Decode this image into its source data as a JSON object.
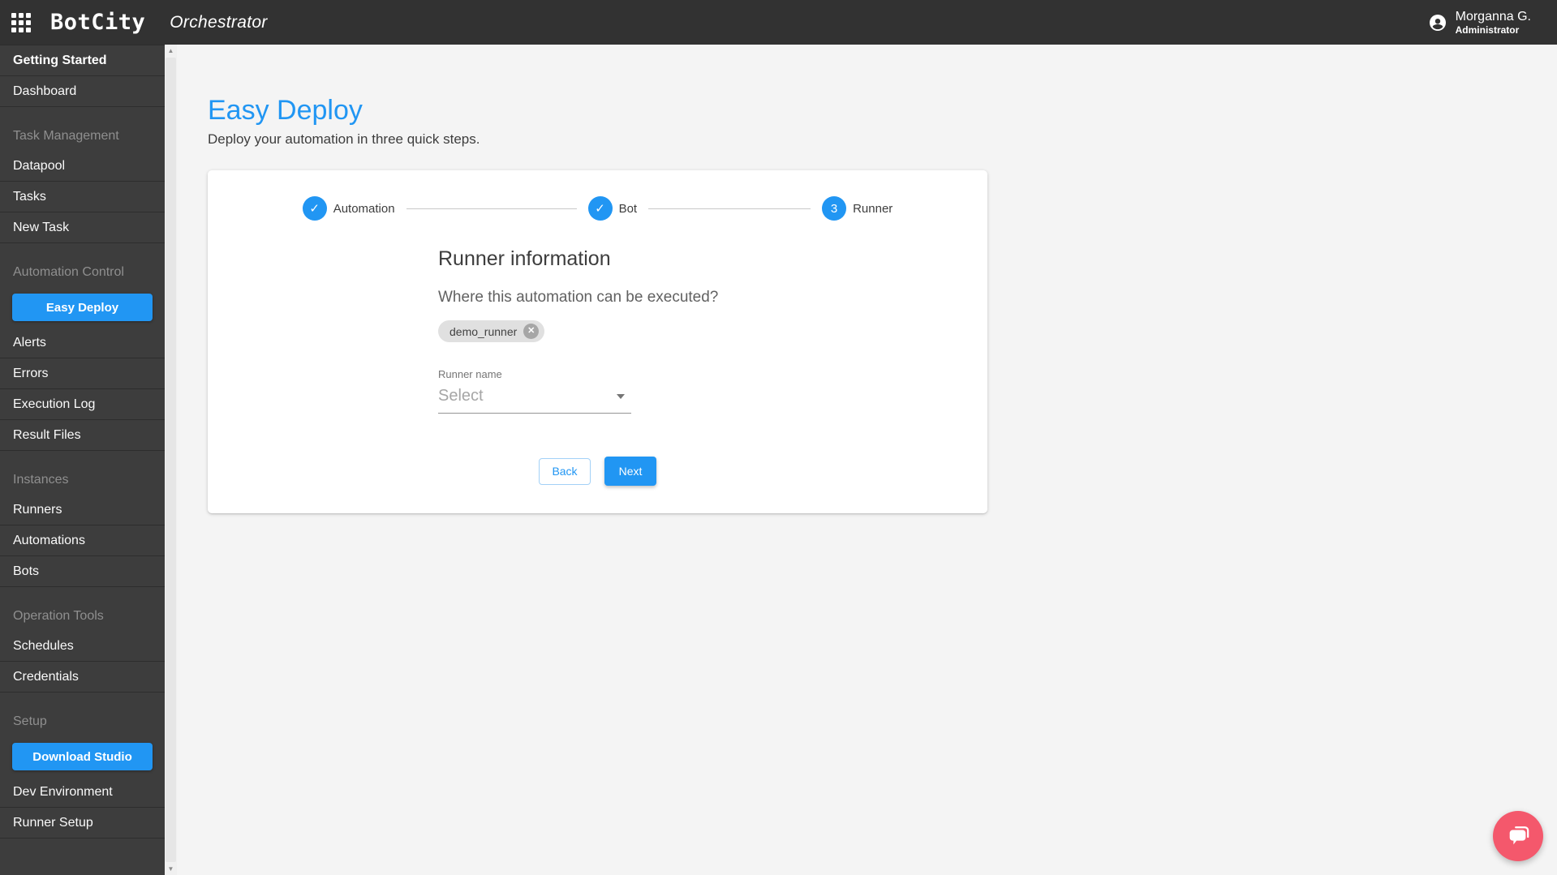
{
  "topbar": {
    "logo": "BotCity",
    "app_title": "Orchestrator",
    "user": {
      "name": "Morganna G.",
      "role": "Administrator"
    }
  },
  "sidebar": {
    "entries": [
      {
        "type": "link-bold",
        "label": "Getting Started"
      },
      {
        "type": "link",
        "label": "Dashboard"
      },
      {
        "type": "header",
        "label": "Task Management"
      },
      {
        "type": "link",
        "label": "Datapool"
      },
      {
        "type": "link",
        "label": "Tasks"
      },
      {
        "type": "link",
        "label": "New Task"
      },
      {
        "type": "header",
        "label": "Automation Control"
      },
      {
        "type": "button",
        "label": "Easy Deploy"
      },
      {
        "type": "link",
        "label": "Alerts"
      },
      {
        "type": "link",
        "label": "Errors"
      },
      {
        "type": "link",
        "label": "Execution Log"
      },
      {
        "type": "link",
        "label": "Result Files"
      },
      {
        "type": "header",
        "label": "Instances"
      },
      {
        "type": "link",
        "label": "Runners"
      },
      {
        "type": "link",
        "label": "Automations"
      },
      {
        "type": "link",
        "label": "Bots"
      },
      {
        "type": "header",
        "label": "Operation Tools"
      },
      {
        "type": "link",
        "label": "Schedules"
      },
      {
        "type": "link",
        "label": "Credentials"
      },
      {
        "type": "header",
        "label": "Setup"
      },
      {
        "type": "button",
        "label": "Download Studio"
      },
      {
        "type": "link",
        "label": "Dev Environment"
      },
      {
        "type": "link",
        "label": "Runner Setup"
      }
    ]
  },
  "main": {
    "page_title": "Easy Deploy",
    "page_subtitle": "Deploy your automation in three quick steps.",
    "stepper": [
      {
        "icon": "✓",
        "label": "Automation",
        "state": "completed"
      },
      {
        "icon": "✓",
        "label": "Bot",
        "state": "completed"
      },
      {
        "icon": "3",
        "label": "Runner",
        "state": "active"
      }
    ],
    "form": {
      "heading": "Runner information",
      "question": "Where this automation can be executed?",
      "chips": [
        {
          "label": "demo_runner"
        }
      ],
      "select_label": "Runner name",
      "select_placeholder": "Select",
      "back_label": "Back",
      "next_label": "Next"
    }
  },
  "icons": {
    "check": "✓",
    "close": "✕",
    "scroll_up": "▲",
    "scroll_down": "▼"
  },
  "colors": {
    "accent": "#2196f3",
    "topbar": "#323232",
    "sidebar": "#3d3d3d",
    "canvas": "#f4f4f4",
    "chat_fab": "#f4586c"
  }
}
